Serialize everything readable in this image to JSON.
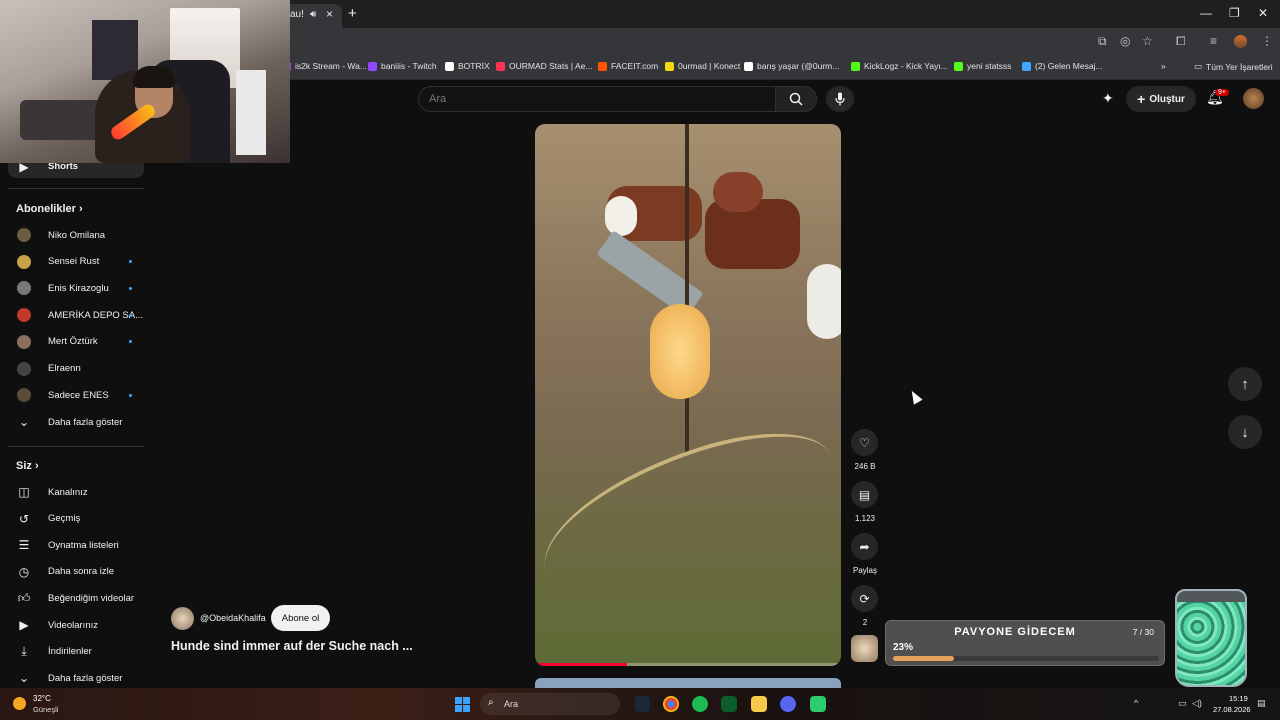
{
  "browser": {
    "tab_title": "au!",
    "tab_mute_icon": "speaker-icon",
    "bookmarks": [
      {
        "label": "is2k Stream - Wa...",
        "color": "#9146ff"
      },
      {
        "label": "baniiis - Twitch",
        "color": "#9146ff"
      },
      {
        "label": "BOTRİX",
        "color": "#ffffff"
      },
      {
        "label": "OURMAD Stats | Ae...",
        "color": "#ff3355"
      },
      {
        "label": "FACEIT.com",
        "color": "#ff5500"
      },
      {
        "label": "0urmad | Konect",
        "color": "#f5d90a"
      },
      {
        "label": "barış yaşar (@0urm...",
        "color": "#ffffff"
      },
      {
        "label": "KickLogz - Kick Yayı...",
        "color": "#53fc18"
      },
      {
        "label": "yeni statsss",
        "color": "#53fc18"
      },
      {
        "label": "(2) Gelen Mesaj...",
        "color": "#3ea6ff"
      }
    ],
    "all_bookmarks": "Tüm Yer İşaretleri"
  },
  "header": {
    "search_placeholder": "Ara",
    "create_label": "Oluştur",
    "notif_badge": "9+"
  },
  "sidebar": {
    "shorts": "Shorts",
    "subscriptions_heading": "Abonelikler",
    "channels": [
      {
        "name": "Niko Omilana",
        "new": false,
        "color": "#6b5a44"
      },
      {
        "name": "Sensei Rust",
        "new": true,
        "color": "#c8a24a"
      },
      {
        "name": "Enis Kirazoglu",
        "new": true,
        "color": "#777777"
      },
      {
        "name": "AMERİKA DEPO SA...",
        "new": true,
        "color": "#c0392b"
      },
      {
        "name": "Mert Öztürk",
        "new": true,
        "color": "#8a6d5b"
      },
      {
        "name": "Elraenn",
        "new": false,
        "color": "#444444"
      },
      {
        "name": "Sadece ENES",
        "new": true,
        "color": "#5a4a3a"
      }
    ],
    "show_more": "Daha fazla göster",
    "you_heading": "Siz",
    "you_items": [
      {
        "label": "Kanalınız",
        "icon": "channel-icon"
      },
      {
        "label": "Geçmiş",
        "icon": "history-icon"
      },
      {
        "label": "Oynatma listeleri",
        "icon": "playlist-icon"
      },
      {
        "label": "Daha sonra izle",
        "icon": "watch-later-icon"
      },
      {
        "label": "Beğendiğim videolar",
        "icon": "like-icon"
      },
      {
        "label": "Videolarınız",
        "icon": "your-videos-icon"
      },
      {
        "label": "İndirilenler",
        "icon": "download-icon"
      },
      {
        "label": "Daha fazla göster",
        "icon": "chevron-down-icon"
      }
    ]
  },
  "video": {
    "channel_handle": "@ObeidaKhalifa",
    "subscribe_label": "Abone ol",
    "title": "Hunde sind immer auf der Suche nach ...",
    "progress": 0.3
  },
  "actions": {
    "likes": "246 B",
    "comments": "1.123",
    "share": "Paylaş",
    "remix": "2"
  },
  "goal_widget": {
    "title": "PAVYONE GİDECEM",
    "count": "7 / 30",
    "percent_label": "23%",
    "percent": 23
  },
  "taskbar": {
    "temperature": "32°C",
    "weather": "Güneşli",
    "search_label": "Ara",
    "time": "15:19",
    "date": "27.08.2026"
  }
}
